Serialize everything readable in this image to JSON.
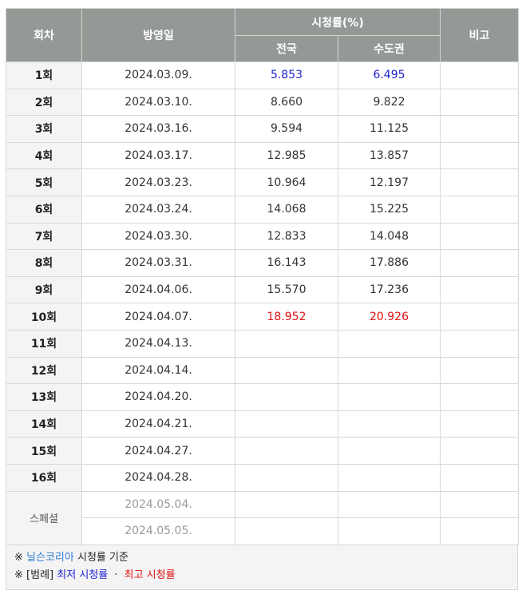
{
  "headers": {
    "episode": "회차",
    "air_date": "방영일",
    "ratings_group": "시청률(%)",
    "nationwide": "전국",
    "capital": "수도권",
    "note": "비고"
  },
  "rows": [
    {
      "ep": "1회",
      "date": "2024.03.09.",
      "nat": "5.853",
      "cap": "6.495",
      "nat_style": "low",
      "cap_style": "low"
    },
    {
      "ep": "2회",
      "date": "2024.03.10.",
      "nat": "8.660",
      "cap": "9.822"
    },
    {
      "ep": "3회",
      "date": "2024.03.16.",
      "nat": "9.594",
      "cap": "11.125"
    },
    {
      "ep": "4회",
      "date": "2024.03.17.",
      "nat": "12.985",
      "cap": "13.857"
    },
    {
      "ep": "5회",
      "date": "2024.03.23.",
      "nat": "10.964",
      "cap": "12.197"
    },
    {
      "ep": "6회",
      "date": "2024.03.24.",
      "nat": "14.068",
      "cap": "15.225"
    },
    {
      "ep": "7회",
      "date": "2024.03.30.",
      "nat": "12.833",
      "cap": "14.048"
    },
    {
      "ep": "8회",
      "date": "2024.03.31.",
      "nat": "16.143",
      "cap": "17.886"
    },
    {
      "ep": "9회",
      "date": "2024.04.06.",
      "nat": "15.570",
      "cap": "17.236"
    },
    {
      "ep": "10회",
      "date": "2024.04.07.",
      "nat": "18.952",
      "cap": "20.926",
      "nat_style": "high",
      "cap_style": "high"
    },
    {
      "ep": "11회",
      "date": "2024.04.13.",
      "nat": "",
      "cap": ""
    },
    {
      "ep": "12회",
      "date": "2024.04.14.",
      "nat": "",
      "cap": ""
    },
    {
      "ep": "13회",
      "date": "2024.04.20.",
      "nat": "",
      "cap": ""
    },
    {
      "ep": "14회",
      "date": "2024.04.21.",
      "nat": "",
      "cap": ""
    },
    {
      "ep": "15회",
      "date": "2024.04.27.",
      "nat": "",
      "cap": ""
    },
    {
      "ep": "16회",
      "date": "2024.04.28.",
      "nat": "",
      "cap": ""
    }
  ],
  "special": {
    "label": "스페셜",
    "dates": [
      "2024.05.04.",
      "2024.05.05."
    ]
  },
  "notes": {
    "line1_mark": "※",
    "line1_link": "닐슨코리아",
    "line1_rest": "시청률 기준",
    "line2_mark": "※",
    "line2_legend": "[범례]",
    "line2_low": "최저 시청률",
    "line2_sep": "·",
    "line2_high": "최고 시청률"
  },
  "colors": {
    "header_bg": "#939994",
    "lowest": "#1a1fd0",
    "highest": "#e01010",
    "link": "#2e7bd1"
  }
}
